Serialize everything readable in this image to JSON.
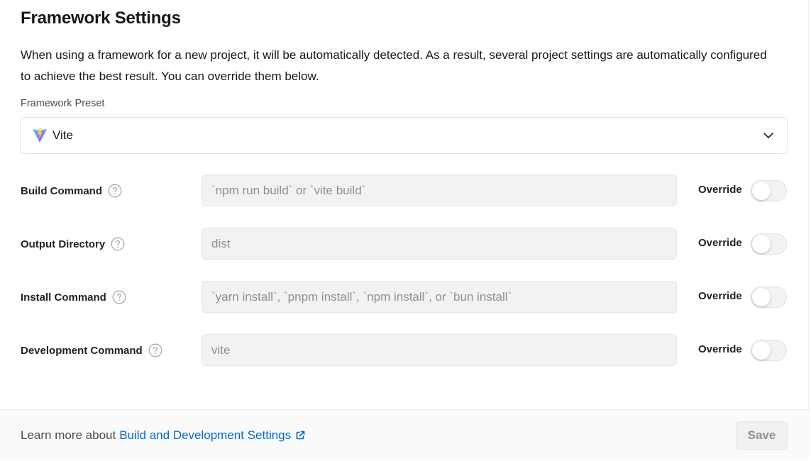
{
  "header": {
    "title": "Framework Settings",
    "description": "When using a framework for a new project, it will be automatically detected. As a result, several project settings are automatically configured to achieve the best result. You can override them below."
  },
  "preset": {
    "label": "Framework Preset",
    "value": "Vite",
    "icon": "vite-logo-icon"
  },
  "rows": [
    {
      "label": "Build Command",
      "placeholder": "`npm run build` or `vite build`",
      "override_label": "Override",
      "override_on": false
    },
    {
      "label": "Output Directory",
      "placeholder": "dist",
      "override_label": "Override",
      "override_on": false
    },
    {
      "label": "Install Command",
      "placeholder": "`yarn install`, `pnpm install`, `npm install`, or `bun install`",
      "override_label": "Override",
      "override_on": false
    },
    {
      "label": "Development Command",
      "placeholder": "vite",
      "override_label": "Override",
      "override_on": false
    }
  ],
  "footer": {
    "learn_prefix": "Learn more about",
    "learn_link": "Build and Development Settings",
    "save_label": "Save"
  },
  "colors": {
    "link": "#0068d6",
    "field_bg": "#f2f2f2",
    "footer_bg": "#fafafa"
  }
}
